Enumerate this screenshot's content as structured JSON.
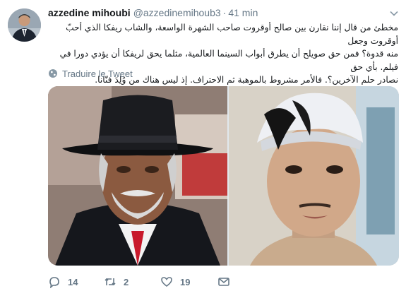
{
  "tweet": {
    "author_name": "azzedine mihoubi",
    "author_handle": "@azzedinemihoub3",
    "separator": "·",
    "timestamp": "41 min",
    "text_lines": [
      "مخطئ من قال إننا نقارن بين صالح أوقروت صاحب الشهرة الواسعة، والشاب ريفكا الذي أحبّ أوقروت وجعل",
      "منه قدوة؟ فمن حق صويلح أن يطرق أبواب السينما العالمية، مثلما يحق لريفكا أن يؤدي دورا في فيلم. بأي حق",
      "نصادر حلم الآخرين؟. فالأمر مشروط بالموهبة ثم الاحتراف. إذ ليس هناك من وُلِدَ فنّانا."
    ],
    "translate_label": "Traduire le Tweet",
    "translate_icon": "globe-icon"
  },
  "media": {
    "left_photo": "elderly-man-black-hat-red-tie",
    "right_photo": "young-man-backwards-cap-selfie"
  },
  "actions": {
    "reply": {
      "icon": "reply-icon",
      "count": "14"
    },
    "retweet": {
      "icon": "retweet-icon",
      "count": "2"
    },
    "like": {
      "icon": "heart-icon",
      "count": "19"
    },
    "message": {
      "icon": "envelope-icon"
    }
  },
  "colors": {
    "text": "#14171a",
    "muted": "#657786",
    "background": "#ffffff"
  }
}
